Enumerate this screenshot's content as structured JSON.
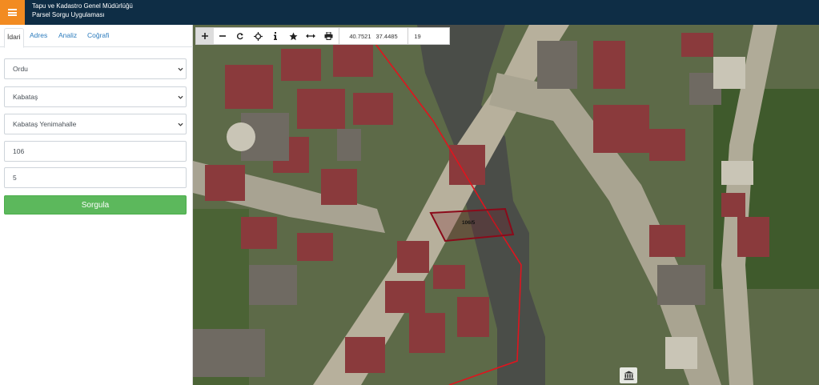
{
  "header": {
    "menu_icon": "hamburger-icon",
    "title_line1": "Tapu ve Kadastro Genel Müdürlüğü",
    "title_line2": "Parsel Sorgu Uygulaması",
    "colors": {
      "bar": "#0e2d45",
      "menu": "#f28b21"
    }
  },
  "sidebar": {
    "tabs": [
      {
        "label": "İdari",
        "active": true
      },
      {
        "label": "Adres",
        "active": false
      },
      {
        "label": "Analiz",
        "active": false
      },
      {
        "label": "Coğrafi",
        "active": false
      }
    ],
    "form": {
      "il": "Ordu",
      "ilce": "Kabataş",
      "mahalle": "Kabataş Yenimahalle",
      "ada": "106",
      "parsel": "5",
      "submit_label": "Sorgula"
    },
    "colors": {
      "submit": "#5cb85c",
      "tab_link": "#2b7bbd"
    }
  },
  "map": {
    "toolbar": {
      "tools": [
        {
          "name": "zoom-in-icon",
          "active": true
        },
        {
          "name": "zoom-out-icon"
        },
        {
          "name": "refresh-icon"
        },
        {
          "name": "locate-icon"
        },
        {
          "name": "info-icon"
        },
        {
          "name": "star-icon"
        },
        {
          "name": "measure-icon"
        },
        {
          "name": "print-icon"
        }
      ],
      "latitude": "40.7521",
      "longitude": "37.4485",
      "zoom": "19"
    },
    "parcel_label": "106/5",
    "bottom_icon": "building-icon",
    "colors": {
      "parcel_outline": "#8b0a1a",
      "boundary_line": "#e0141e"
    }
  }
}
